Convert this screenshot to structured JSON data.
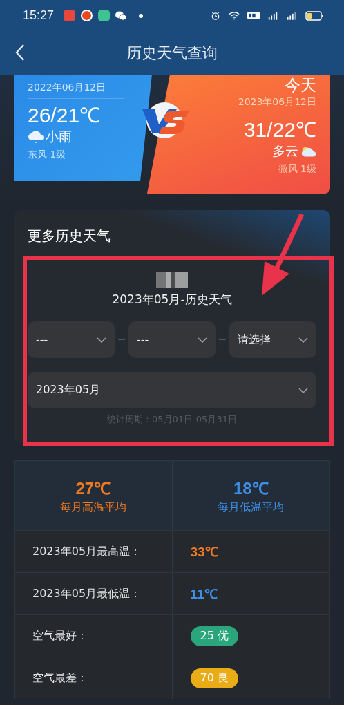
{
  "status_bar": {
    "time": "15:27"
  },
  "header": {
    "title": "历史天气查询"
  },
  "compare": {
    "last_year": {
      "date": "2022年06月12日",
      "temp": "26/21℃",
      "weather": "小雨",
      "wind": "东风 1级"
    },
    "today": {
      "label": "今天",
      "date": "2023年06月12日",
      "temp": "31/22℃",
      "weather": "多云",
      "wind": "微风 1级"
    }
  },
  "more_history": {
    "title": "更多历史天气",
    "subtitle": "2023年05月-历史天气",
    "selects": [
      {
        "value": "---"
      },
      {
        "value": "---"
      },
      {
        "value": "请选择"
      }
    ],
    "month_select": {
      "value": "2023年05月"
    },
    "period": "统计周期：05月01日-05月31日"
  },
  "stats": {
    "averages": [
      {
        "value": "27℃",
        "label": "每月高温平均",
        "color": "#f07a22"
      },
      {
        "value": "18℃",
        "label": "每月低温平均",
        "color": "#3d8fe6"
      }
    ],
    "rows": [
      {
        "label": "2023年05月最高温：",
        "value": "33℃",
        "kind": "text",
        "color": "#f07a22"
      },
      {
        "label": "2023年05月最低温：",
        "value": "11℃",
        "kind": "text",
        "color": "#3d8fe6"
      },
      {
        "label": "空气最好：",
        "value": "25 优",
        "kind": "badge",
        "color": "#2aa57c"
      },
      {
        "label": "空气最差：",
        "value": "70 良",
        "kind": "badge",
        "color": "#e9ac17"
      }
    ]
  }
}
